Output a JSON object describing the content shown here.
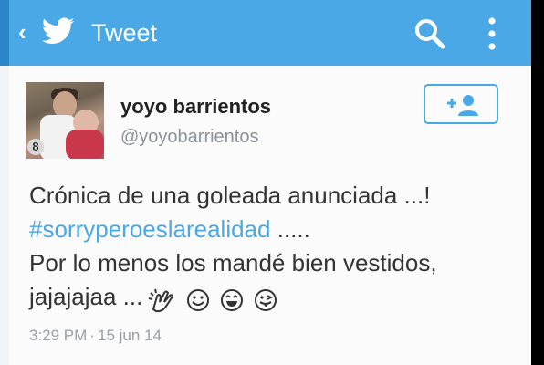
{
  "header": {
    "title": "Tweet",
    "back_icon": "chevron-left-icon",
    "logo_icon": "twitter-bird-icon",
    "search_icon": "search-icon",
    "menu_icon": "overflow-menu-icon",
    "bar_color": "#4aa8e6"
  },
  "tweet": {
    "display_name": "yoyo barrientos",
    "handle": "@yoyobarrientos",
    "avatar_badge": "8",
    "follow_icon": "follow-user-icon",
    "text_line1": "Crónica de una goleada anunciada ...!",
    "hashtag": "#sorryperoeslarealidad",
    "text_line2_suffix": " .....",
    "text_line3": "Por lo menos los mandé bien vestidos,",
    "text_line4": "jajajajaa ...",
    "emojis": [
      "clapping-hands-icon",
      "smiling-face-icon",
      "grinning-face-icon",
      "tongue-face-icon"
    ],
    "time": "3:29 PM",
    "separator": "·",
    "date": "15 jun 14",
    "accent_color": "#4aa8e6"
  }
}
